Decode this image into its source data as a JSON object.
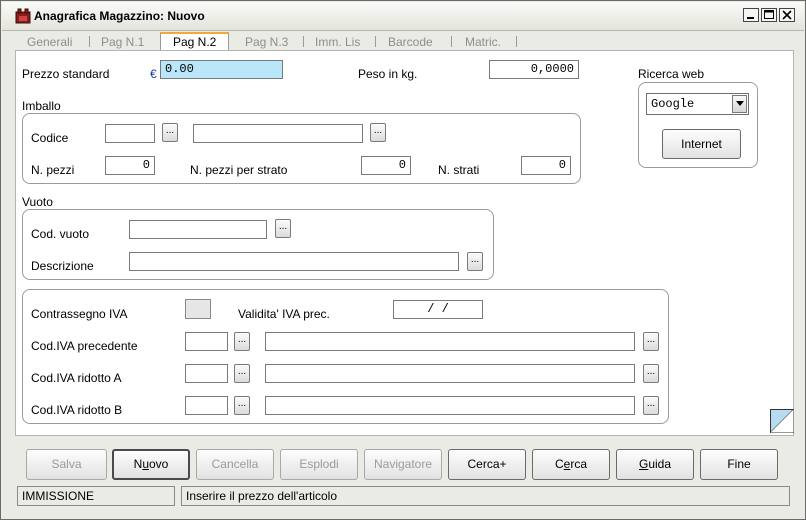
{
  "window": {
    "title": "Anagrafica Magazzino: Nuovo"
  },
  "icons": {
    "app": "app-icon",
    "minimize": "minimize-icon",
    "maximize": "maximize-icon",
    "close": "close-icon",
    "resize": "resize-grip-icon",
    "dropdown": "chevron-down-icon"
  },
  "colors": {
    "tab_accent": "#f2a83c",
    "highlight_field": "#b9e6f8",
    "window_bg": "#ebebe6"
  },
  "tabs": [
    {
      "label": "Generali"
    },
    {
      "label": "Pag N.1"
    },
    {
      "label": "Pag N.2",
      "active": true
    },
    {
      "label": "Pag N.3"
    },
    {
      "label": "Imm. Lis"
    },
    {
      "label": "Barcode"
    },
    {
      "label": "Matric."
    }
  ],
  "form": {
    "prezzo_label": "Prezzo standard",
    "currency": "€",
    "prezzo_value": "0.00",
    "peso_label": "Peso in kg.",
    "peso_value": "0,0000",
    "ricerca_label": "Ricerca web",
    "ricerca_value": "Google",
    "internet_button": "Internet",
    "browse_button": "...",
    "imballo": {
      "title": "Imballo",
      "codice_label": "Codice",
      "codice_value": "",
      "codice_desc": "",
      "npezzi_label": "N. pezzi",
      "npezzi_value": "0",
      "npezzi_strato_label": "N. pezzi per strato",
      "npezzi_strato_value": "0",
      "nstrati_label": "N. strati",
      "nstrati_value": "0"
    },
    "vuoto": {
      "title": "Vuoto",
      "cod_label": "Cod. vuoto",
      "cod_value": "",
      "desc_label": "Descrizione",
      "desc_value": ""
    },
    "iva": {
      "contrassegno_label": "Contrassegno IVA",
      "validita_label": "Validita' IVA prec.",
      "validita_value": "/   /",
      "precedente_label": "Cod.IVA precedente",
      "ridotto_a_label": "Cod.IVA ridotto A",
      "ridotto_b_label": "Cod.IVA ridotto B"
    }
  },
  "buttons": {
    "salva": "Salva",
    "nuovo_pre": "N",
    "nuovo_ul": "u",
    "nuovo_post": "ovo",
    "cancella": "Cancella",
    "esplodi": "Esplodi",
    "navigatore": "Navigatore",
    "cercaplus": "Cerca+",
    "cerca_pre": "C",
    "cerca_ul": "e",
    "cerca_post": "rca",
    "guida_pre": "",
    "guida_ul": "G",
    "guida_post": "uida",
    "fine": "Fine"
  },
  "status": {
    "mode": "IMMISSIONE",
    "message": "Inserire il prezzo dell'articolo"
  }
}
